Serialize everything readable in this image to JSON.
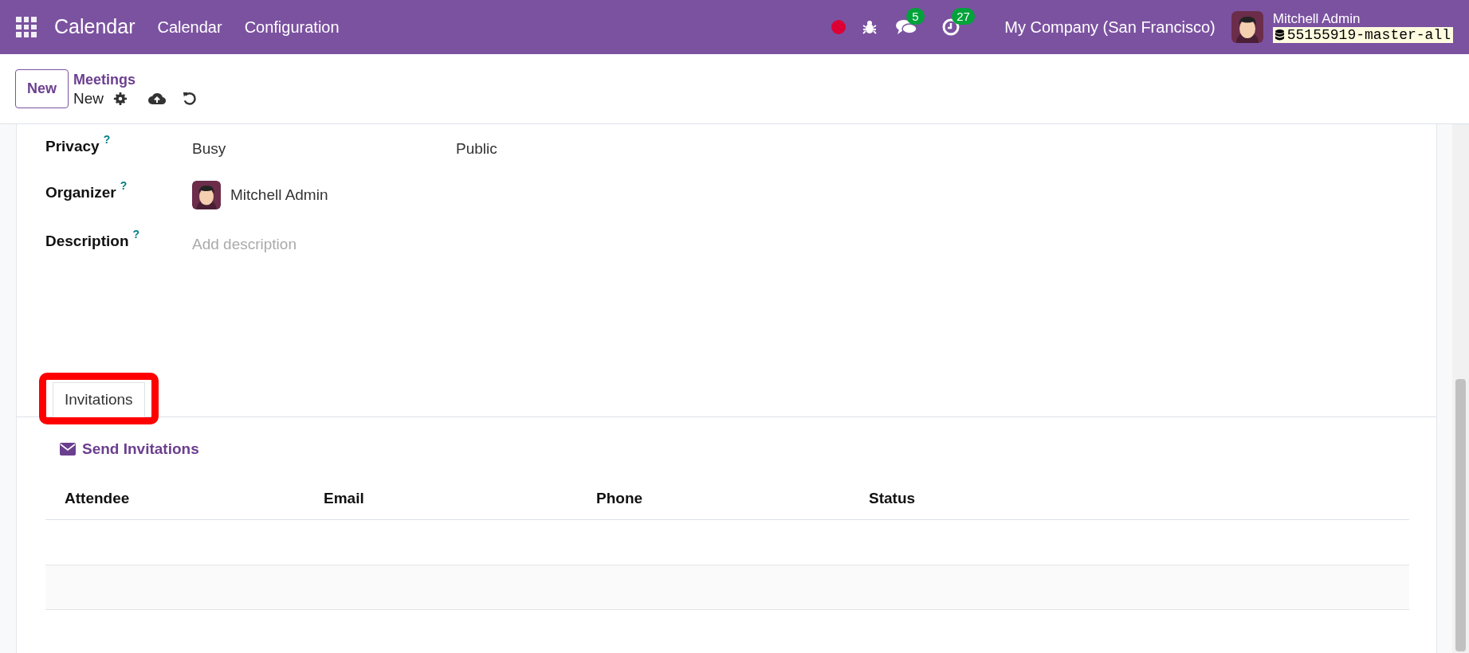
{
  "navbar": {
    "app_name": "Calendar",
    "menu": [
      "Calendar",
      "Configuration"
    ],
    "messages_count": "5",
    "activities_count": "27",
    "company": "My Company (San Francisco)",
    "user": "Mitchell Admin",
    "database": "55155919-master-all"
  },
  "control_panel": {
    "new_button": "New",
    "breadcrumb": "Meetings",
    "current": "New"
  },
  "fields": [
    {
      "kind": "pair",
      "label": "Privacy",
      "help": "?",
      "values": [
        "Busy",
        "Public"
      ]
    },
    {
      "kind": "user",
      "label": "Organizer",
      "help": "?",
      "value": "Mitchell Admin"
    },
    {
      "kind": "html",
      "label": "Description",
      "help": "?",
      "placeholder": "Add description"
    }
  ],
  "tabs": [
    {
      "label": "Invitations",
      "selected": true,
      "highlighted": true
    }
  ],
  "send_button": "Send Invitations",
  "table": {
    "columns": [
      "Attendee",
      "Email",
      "Phone",
      "Status"
    ]
  }
}
